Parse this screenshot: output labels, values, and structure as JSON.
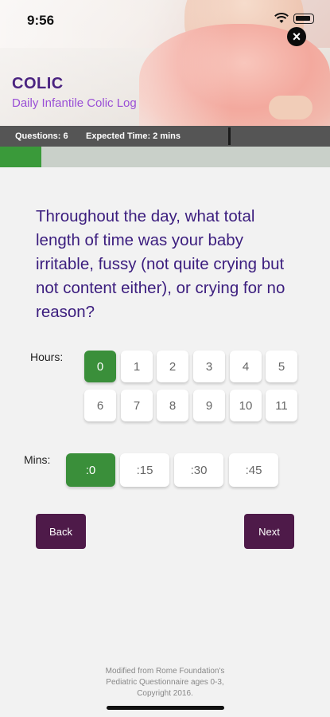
{
  "status_bar": {
    "time": "9:56"
  },
  "header": {
    "title": "COLIC",
    "subtitle": "Daily Infantile Colic Log",
    "close_icon": "close-icon"
  },
  "info_bar": {
    "questions": "Questions: 6",
    "expected_time": "Expected Time: 2 mins"
  },
  "progress": {
    "fraction": 0.125,
    "color": "#3a9a3a"
  },
  "question": {
    "text": "Throughout the day, what total length of time was your baby irritable, fussy (not quite crying but not content either), or crying for no reason?"
  },
  "hours": {
    "label": "Hours:",
    "options": [
      "0",
      "1",
      "2",
      "3",
      "4",
      "5",
      "6",
      "7",
      "8",
      "9",
      "10",
      "11"
    ],
    "selected": "0"
  },
  "mins": {
    "label": "Mins:",
    "options": [
      ":0",
      ":15",
      ":30",
      ":45"
    ],
    "selected": ":0"
  },
  "nav": {
    "back": "Back",
    "next": "Next"
  },
  "footer": {
    "line1": "Modified from Rome Foundation's",
    "line2": "Pediatric Questionnaire ages 0-3,",
    "line3": "Copyright 2016."
  },
  "colors": {
    "selected_green": "#3a8f3a",
    "button_purple": "#4e1a49",
    "title_purple": "#4a2380",
    "question_purple": "#3b1d7e"
  }
}
